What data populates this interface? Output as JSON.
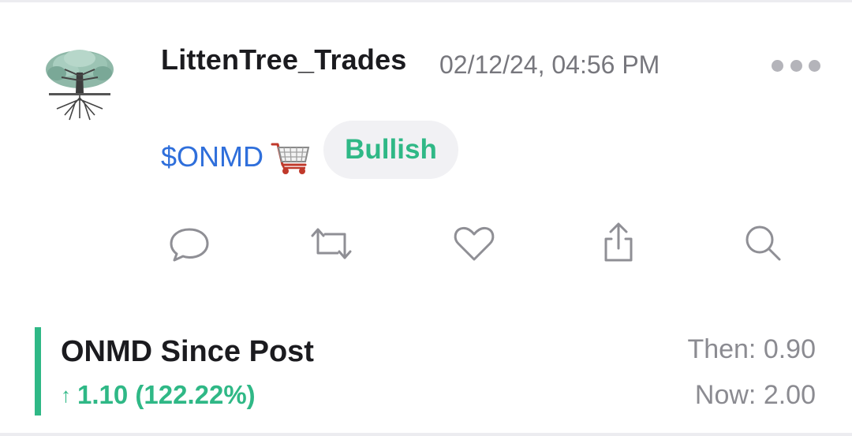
{
  "post": {
    "username": "LittenTree_Trades",
    "timestamp": "02/12/24, 04:56 PM",
    "ticker": "$ONMD",
    "sentiment": "Bullish",
    "icons": {
      "avatar": "tree-logo",
      "more": "more-options-icon",
      "cart": "shopping-cart-icon"
    }
  },
  "actions": [
    {
      "name": "comment",
      "icon": "comment-icon"
    },
    {
      "name": "reshare",
      "icon": "repost-icon"
    },
    {
      "name": "like",
      "icon": "heart-icon"
    },
    {
      "name": "share",
      "icon": "share-icon"
    },
    {
      "name": "search",
      "icon": "search-icon"
    }
  ],
  "performance": {
    "title": "ONMD Since Post",
    "arrow": "↑",
    "change": "1.10 (122.22%)",
    "then": "Then: 0.90",
    "now": "Now: 2.00",
    "change_fraction": 1.2222
  },
  "colors": {
    "positive": "#2fb886",
    "ticker": "#2f6fdb",
    "icon": "#8f8f95",
    "text": "#1b1b1f",
    "muted": "#77777d"
  }
}
